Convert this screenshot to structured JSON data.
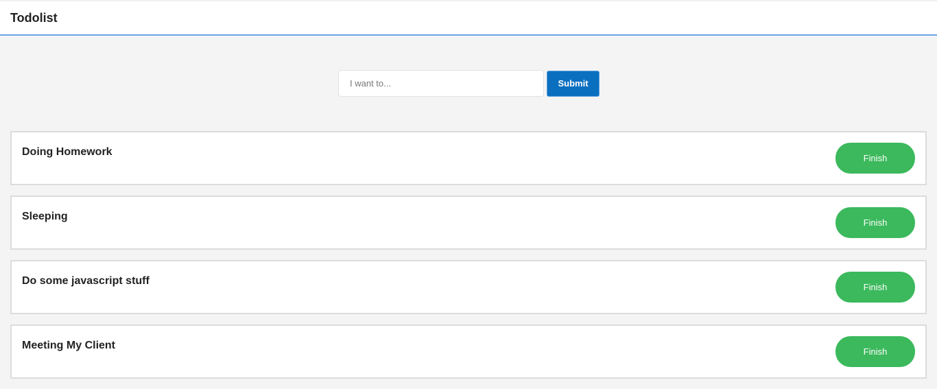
{
  "navbar": {
    "title": "Todolist"
  },
  "form": {
    "input_placeholder": "I want to...",
    "input_value": "",
    "submit_label": "Submit"
  },
  "todos": [
    {
      "title": "Doing Homework",
      "action_label": "Finish"
    },
    {
      "title": "Sleeping",
      "action_label": "Finish"
    },
    {
      "title": "Do some javascript stuff",
      "action_label": "Finish"
    },
    {
      "title": "Meeting My Client",
      "action_label": "Finish"
    }
  ],
  "colors": {
    "accent_border": "#6aa4e6",
    "submit_bg": "#0b6fc0",
    "finish_bg": "#3bb95c",
    "page_bg": "#f4f4f4"
  }
}
